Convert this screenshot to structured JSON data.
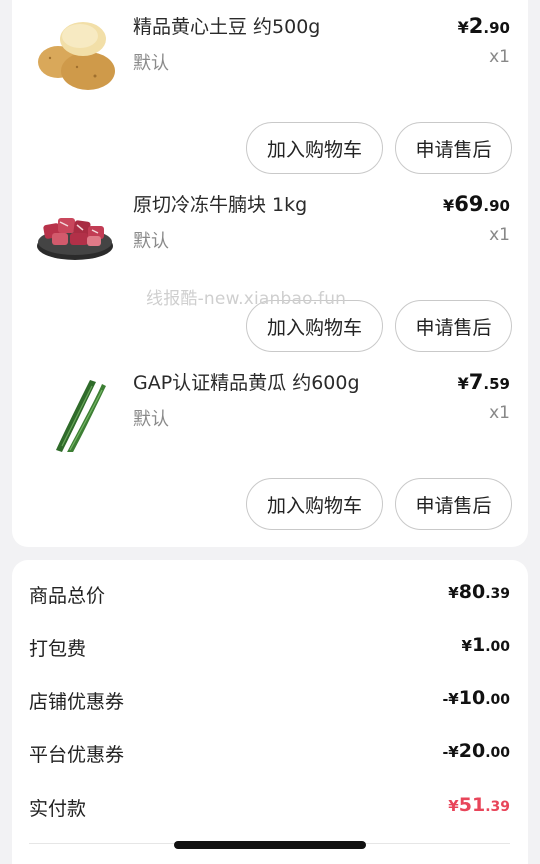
{
  "items": [
    {
      "name": "精品黄心土豆 约500g",
      "spec": "默认",
      "price_currency": "¥",
      "price_int": "2",
      "price_dec": ".90",
      "qty": "x1",
      "image": "potato-image",
      "add_to_cart": "加入购物车",
      "after_sale": "申请售后"
    },
    {
      "name": "原切冷冻牛腩块 1kg",
      "spec": "默认",
      "price_currency": "¥",
      "price_int": "69",
      "price_dec": ".90",
      "qty": "x1",
      "image": "beef-image",
      "add_to_cart": "加入购物车",
      "after_sale": "申请售后"
    },
    {
      "name": "GAP认证精品黄瓜 约600g",
      "spec": "默认",
      "price_currency": "¥",
      "price_int": "7",
      "price_dec": ".59",
      "qty": "x1",
      "image": "cucumber-image",
      "add_to_cart": "加入购物车",
      "after_sale": "申请售后"
    }
  ],
  "watermark": "线报酷-new.xianbao.fun",
  "summary": {
    "goods_total": {
      "label": "商品总价",
      "prefix": "",
      "currency": "¥",
      "int": "80",
      "dec": ".39"
    },
    "packing_fee": {
      "label": "打包费",
      "prefix": "",
      "currency": "¥",
      "int": "1",
      "dec": ".00"
    },
    "shop_coupon": {
      "label": "店铺优惠券",
      "prefix": "-",
      "currency": "¥",
      "int": "10",
      "dec": ".00"
    },
    "platform_coupon": {
      "label": "平台优惠券",
      "prefix": "-",
      "currency": "¥",
      "int": "20",
      "dec": ".00"
    },
    "paid": {
      "label": "实付款",
      "prefix": "",
      "currency": "¥",
      "int": "51",
      "dec": ".39"
    }
  },
  "colors": {
    "pay_amount": "#e8455a",
    "background": "#f2f2f4"
  }
}
